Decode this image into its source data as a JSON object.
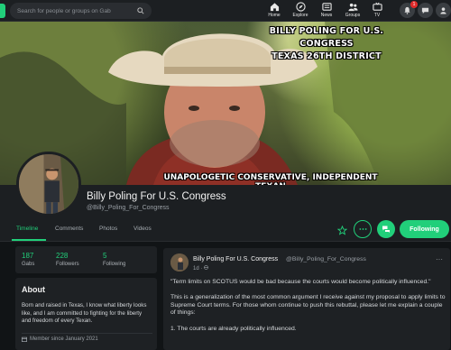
{
  "nav": {
    "search_placeholder": "Search for people or groups on Gab",
    "items": [
      {
        "label": "Home"
      },
      {
        "label": "Explore"
      },
      {
        "label": "News"
      },
      {
        "label": "Groups"
      },
      {
        "label": "TV"
      }
    ],
    "notification_count": "1"
  },
  "cover": {
    "title_line1": "BILLY POLING FOR U.S. CONGRESS",
    "title_line2": "TEXAS 26TH DISTRICT",
    "tagline": "UNAPOLOGETIC CONSERVATIVE, INDEPENDENT TEXAN"
  },
  "profile": {
    "name": "Billy Poling For U.S. Congress",
    "handle": "@Billy_Poling_For_Congress"
  },
  "tabs": [
    {
      "label": "Timeline"
    },
    {
      "label": "Comments"
    },
    {
      "label": "Photos"
    },
    {
      "label": "Videos"
    }
  ],
  "actions": {
    "follow_label": "Following"
  },
  "stats": [
    {
      "value": "187",
      "label": "Gabs"
    },
    {
      "value": "228",
      "label": "Followers"
    },
    {
      "value": "5",
      "label": "Following"
    }
  ],
  "about": {
    "heading": "About",
    "text": "Born and raised in Texas, I know what liberty looks like, and I am committed to fighting for the liberty and freedom of every Texan.",
    "member_since": "Member since January 2021"
  },
  "post": {
    "author": "Billy Poling For U.S. Congress",
    "handle": "@Billy_Poling_For_Congress",
    "time": "1d ·",
    "more": "···",
    "paragraphs": [
      "\"Term limits on SCOTUS would be bad because the courts would become politically influenced.\"",
      "This is a generalization of the most common argument I receive against my proposal to apply limits to Supreme Court terms. For those whom continue to push this rebuttal, please let me explain a couple of things:",
      "1. The courts are already politically influenced."
    ]
  },
  "colors": {
    "accent": "#21cf7a",
    "background": "#111416",
    "panel": "#1e2124",
    "notification": "#e02a2a"
  }
}
